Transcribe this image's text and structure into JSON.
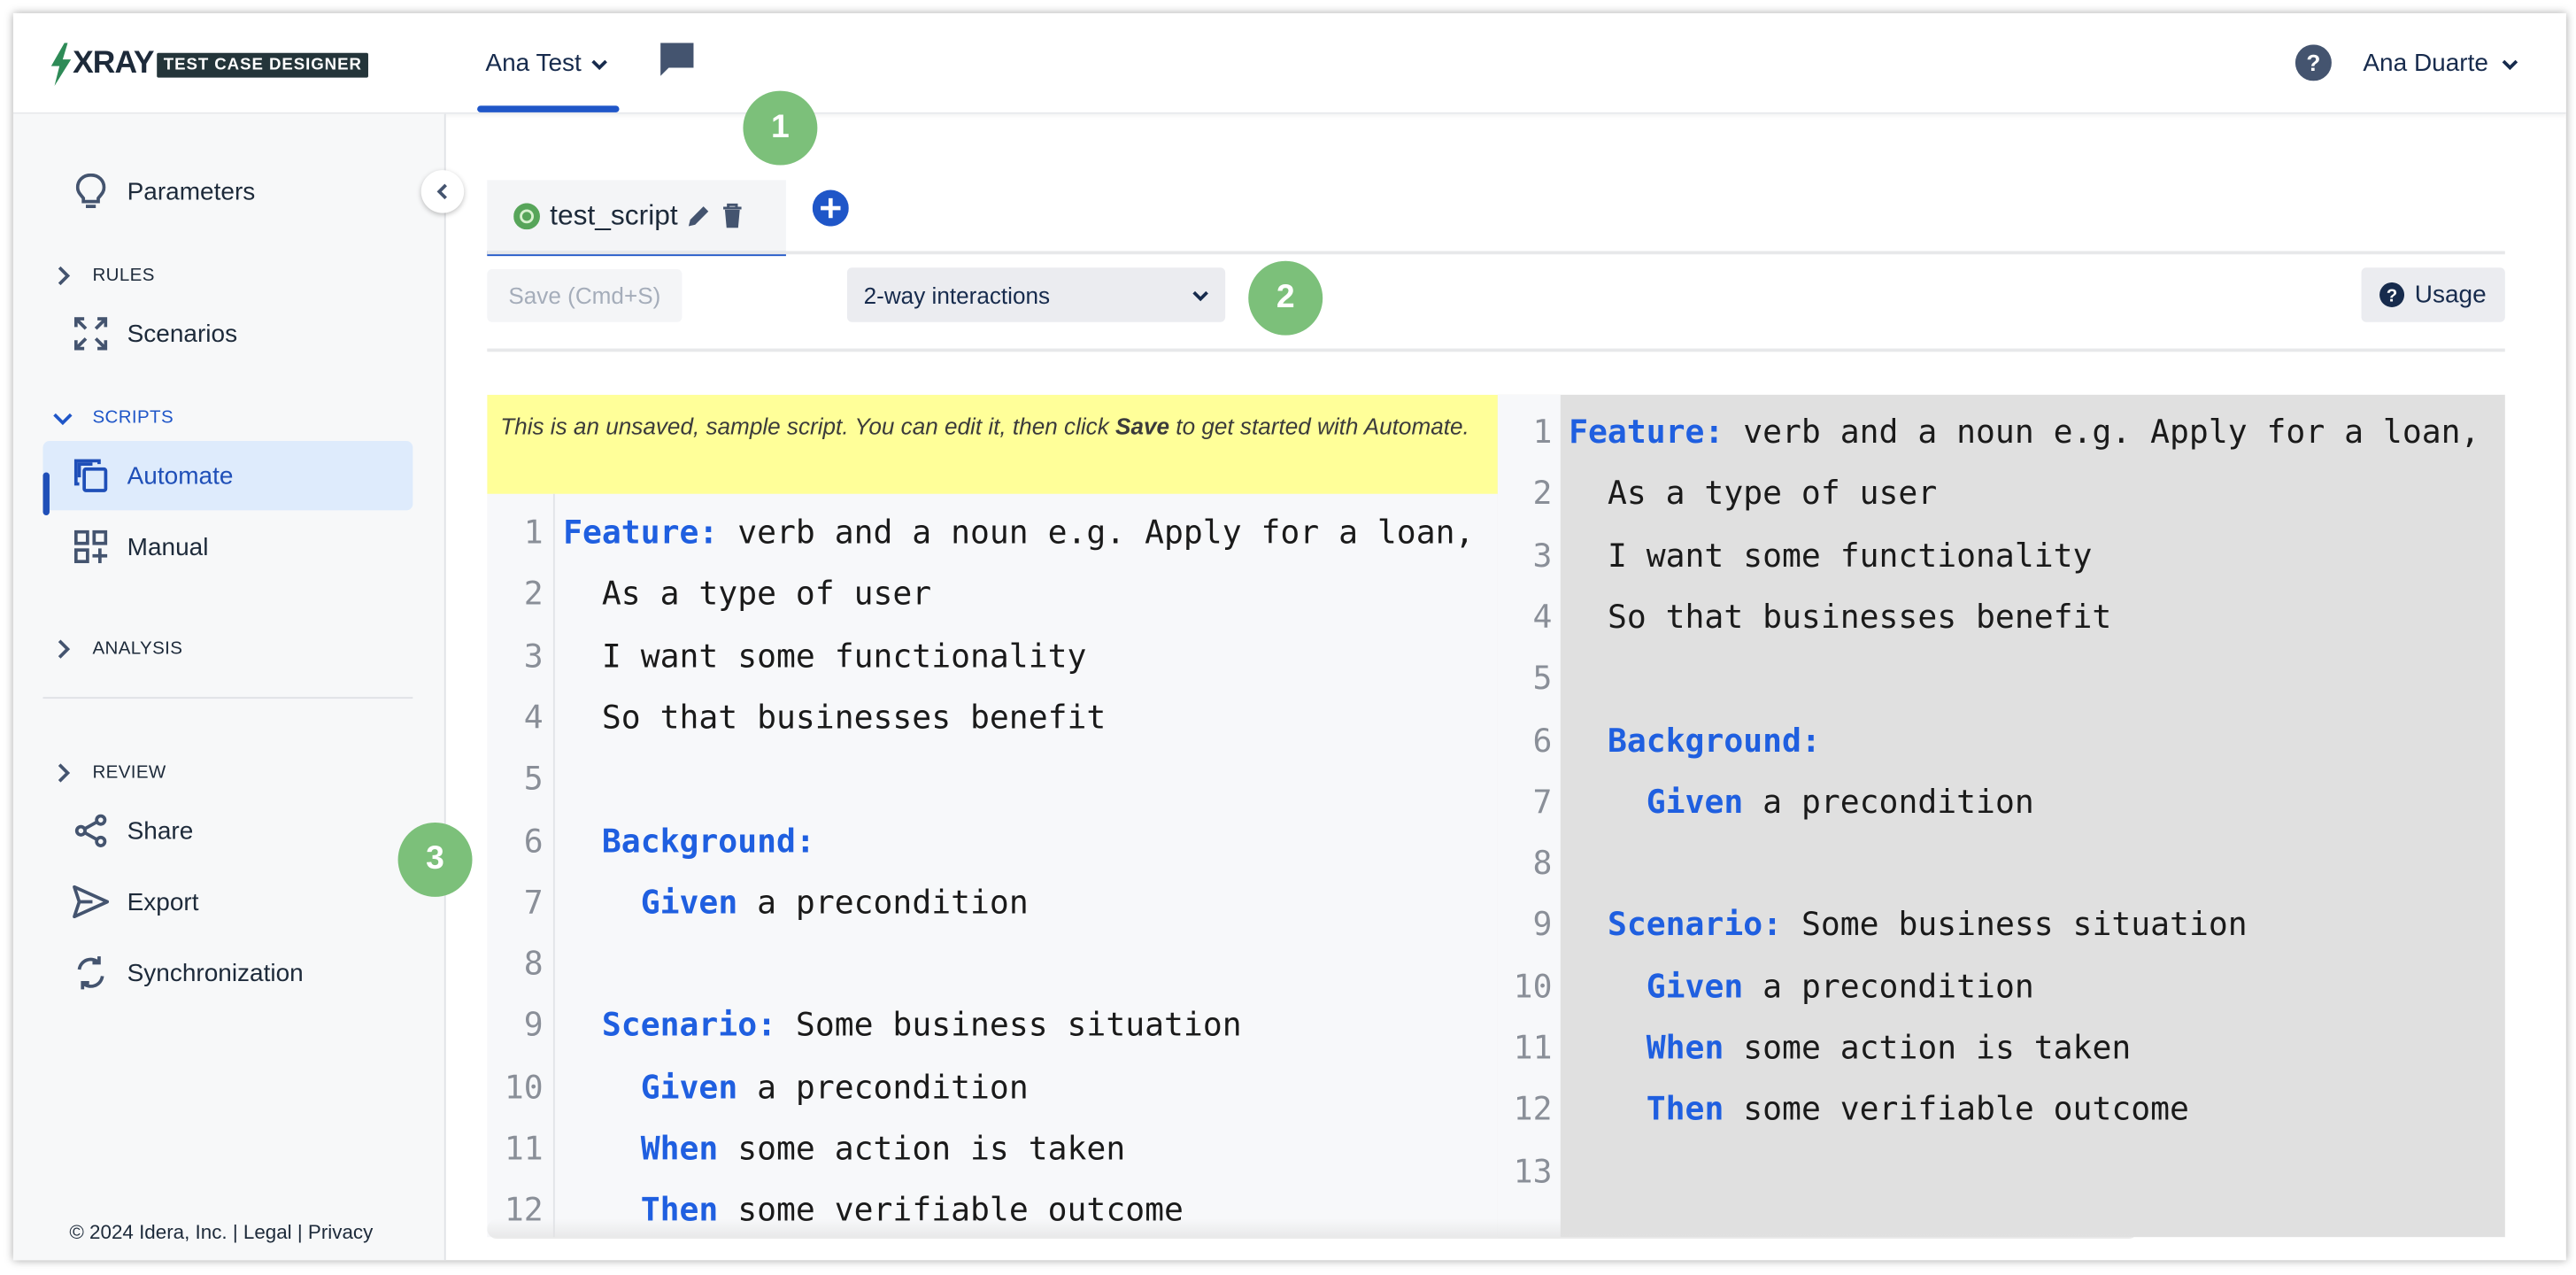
{
  "app": {
    "logo_text": "XRAY",
    "logo_tag": "TEST CASE DESIGNER",
    "project": "Ana Test",
    "user": "Ana Duarte"
  },
  "sidebar": {
    "items": [
      {
        "label": "Parameters",
        "icon": "lightbulb-icon"
      },
      {
        "label": "Scenarios",
        "icon": "expand-arrows-icon"
      },
      {
        "label": "Automate",
        "icon": "copy-icon",
        "active": true
      },
      {
        "label": "Manual",
        "icon": "grid-plus-icon"
      },
      {
        "label": "Share",
        "icon": "share-icon"
      },
      {
        "label": "Export",
        "icon": "send-icon"
      },
      {
        "label": "Synchronization",
        "icon": "sync-icon"
      }
    ],
    "sections": [
      {
        "label": "RULES",
        "state": "collapsed"
      },
      {
        "label": "SCRIPTS",
        "state": "expanded"
      },
      {
        "label": "ANALYSIS",
        "state": "collapsed"
      },
      {
        "label": "REVIEW",
        "state": "collapsed"
      }
    ],
    "footer": "© 2024 Idera, Inc. | Legal | Privacy"
  },
  "badges": [
    "1",
    "2",
    "3"
  ],
  "editor": {
    "tab_name": "test_script",
    "save_label": "Save (Cmd+S)",
    "interactions_selected": "2-way interactions",
    "usage_label": "Usage",
    "notice_pre": "This is an unsaved, sample script. You can edit it, then click ",
    "notice_bold": "Save",
    "notice_post": " to get started with Automate."
  },
  "code_left": [
    {
      "n": "1",
      "kw": "Feature:",
      "text": " verb and a noun e.g. Apply for a loan,",
      "indent": ""
    },
    {
      "n": "2",
      "kw": "",
      "text": "As a type of user",
      "indent": "  "
    },
    {
      "n": "3",
      "kw": "",
      "text": "I want some functionality",
      "indent": "  "
    },
    {
      "n": "4",
      "kw": "",
      "text": "So that businesses benefit",
      "indent": "  "
    },
    {
      "n": "5",
      "kw": "",
      "text": "",
      "indent": ""
    },
    {
      "n": "6",
      "kw": "Background:",
      "text": "",
      "indent": "  "
    },
    {
      "n": "7",
      "kw": "Given",
      "text": " a precondition",
      "indent": "    "
    },
    {
      "n": "8",
      "kw": "",
      "text": "",
      "indent": ""
    },
    {
      "n": "9",
      "kw": "Scenario:",
      "text": " Some business situation",
      "indent": "  "
    },
    {
      "n": "10",
      "kw": "Given",
      "text": " a precondition",
      "indent": "    "
    },
    {
      "n": "11",
      "kw": "When",
      "text": " some action is taken",
      "indent": "    "
    },
    {
      "n": "12",
      "kw": "Then",
      "text": " some verifiable outcome",
      "indent": "    "
    }
  ],
  "code_right": [
    {
      "n": "1",
      "kw": "Feature:",
      "text": " verb and a noun e.g. Apply for a loan,",
      "indent": ""
    },
    {
      "n": "2",
      "kw": "",
      "text": "As a type of user",
      "indent": "  "
    },
    {
      "n": "3",
      "kw": "",
      "text": "I want some functionality",
      "indent": "  "
    },
    {
      "n": "4",
      "kw": "",
      "text": "So that businesses benefit",
      "indent": "  "
    },
    {
      "n": "5",
      "kw": "",
      "text": "",
      "indent": ""
    },
    {
      "n": "6",
      "kw": "Background:",
      "text": "",
      "indent": "  "
    },
    {
      "n": "7",
      "kw": "Given",
      "text": " a precondition",
      "indent": "    "
    },
    {
      "n": "8",
      "kw": "",
      "text": "",
      "indent": ""
    },
    {
      "n": "9",
      "kw": "Scenario:",
      "text": " Some business situation",
      "indent": "  "
    },
    {
      "n": "10",
      "kw": "Given",
      "text": " a precondition",
      "indent": "    "
    },
    {
      "n": "11",
      "kw": "When",
      "text": " some action is taken",
      "indent": "    "
    },
    {
      "n": "12",
      "kw": "Then",
      "text": " some verifiable outcome",
      "indent": "    "
    },
    {
      "n": "13",
      "kw": "",
      "text": "",
      "indent": ""
    }
  ],
  "colors": {
    "accent": "#1f56c8",
    "keyword": "#1f5fe0",
    "badge": "#7cc07a",
    "notice_bg": "#ffff99",
    "active_bg": "#deebfc"
  }
}
